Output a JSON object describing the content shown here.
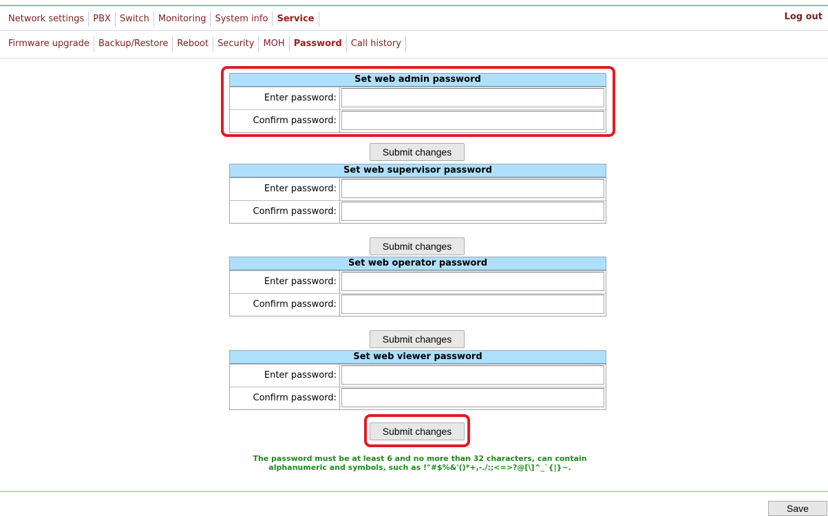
{
  "main_menu": {
    "items": [
      "Network settings",
      "PBX",
      "Switch",
      "Monitoring",
      "System info",
      "Service"
    ],
    "active": "Service",
    "logout_label": "Log out"
  },
  "sub_menu": {
    "items": [
      "Firmware upgrade",
      "Backup/Restore",
      "Reboot",
      "Security",
      "MOH",
      "Password",
      "Call history"
    ],
    "active": "Password"
  },
  "sections": [
    {
      "title": "Set web admin password",
      "enter_label": "Enter password:",
      "confirm_label": "Confirm password:",
      "enter_value": "",
      "confirm_value": "",
      "submit_label": "Submit changes"
    },
    {
      "title": "Set web supervisor password",
      "enter_label": "Enter password:",
      "confirm_label": "Confirm password:",
      "enter_value": "",
      "confirm_value": "",
      "submit_label": "Submit changes"
    },
    {
      "title": "Set web operator password",
      "enter_label": "Enter password:",
      "confirm_label": "Confirm password:",
      "enter_value": "",
      "confirm_value": "",
      "submit_label": "Submit changes"
    },
    {
      "title": "Set web viewer password",
      "enter_label": "Enter password:",
      "confirm_label": "Confirm password:",
      "enter_value": "",
      "confirm_value": "",
      "submit_label": "Submit changes"
    }
  ],
  "note": {
    "line1": "The password must be at least 6 and no more than 32 characters, can contain",
    "line2": "alphanumeric and symbols, such as !\"#$%&'()*+,-./:;<=>?@[\\]^_`{|}~."
  },
  "save_label": "Save",
  "colors": {
    "menu_text": "#7a1f1f",
    "table_header": "#aee0fb",
    "highlight": "#e01b24",
    "note_text": "#1d8a1d"
  }
}
